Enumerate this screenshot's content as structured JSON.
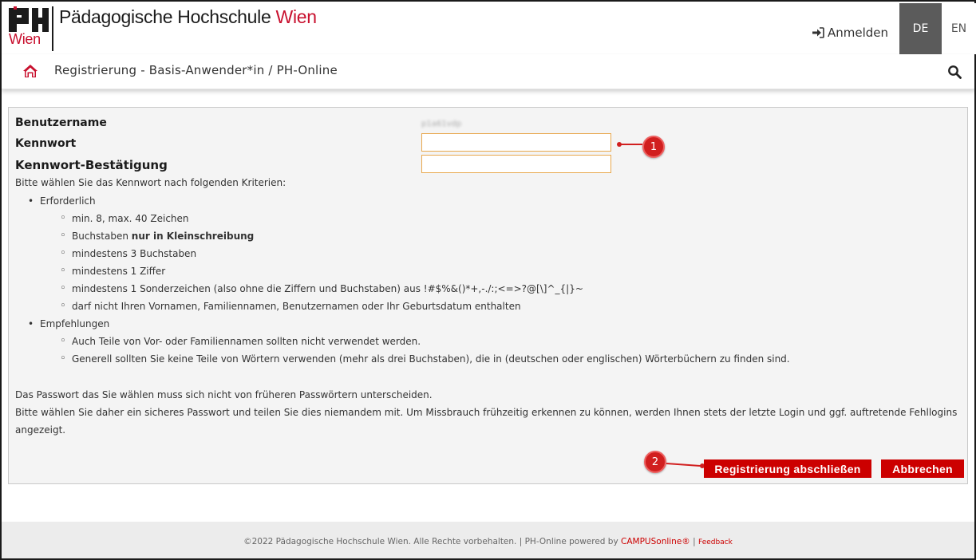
{
  "header": {
    "logo_wien": "Wien",
    "school_name": "Pädagogische Hochschule",
    "school_name_city": "Wien",
    "login_label": "Anmelden",
    "lang_de": "DE",
    "lang_en": "EN"
  },
  "nav": {
    "breadcrumb": "Registrierung - Basis-Anwender*in  / PH-Online"
  },
  "form": {
    "username_label": "Benutzername",
    "username_value": "p1a61vdp",
    "password_label": "Kennwort",
    "password_confirm_label": "Kennwort-Bestätigung",
    "password_value": "",
    "password_confirm_value": "",
    "intro": "Bitte wählen Sie das Kennwort nach folgenden Kriterien:",
    "required_heading": "Erforderlich",
    "required_items": {
      "i0": "min. 8, max. 40 Zeichen",
      "i1_pre": "Buchstaben ",
      "i1_bold": "nur in Kleinschreibung",
      "i2": "mindestens 3 Buchstaben",
      "i3": "mindestens 1 Ziffer",
      "i4": "mindestens 1 Sonderzeichen (also ohne die Ziffern und Buchstaben) aus !#$%&()*+,-./:;<=>?@[\\]^_{|}~",
      "i5": "darf nicht Ihren Vornamen, Familiennamen, Benutzernamen oder Ihr Geburtsdatum enthalten"
    },
    "recommend_heading": "Empfehlungen",
    "recommend_items": {
      "i0": "Auch Teile von Vor- oder Familiennamen sollten nicht verwendet werden.",
      "i1": "Generell sollten Sie keine Teile von Wörtern verwenden (mehr als drei Buchstaben), die in (deutschen oder englischen) Wörterbüchern zu finden sind."
    },
    "note1": "Das Passwort das Sie wählen muss sich nicht von früheren Passwörtern unterscheiden.",
    "note2": "Bitte wählen Sie daher ein sicheres Passwort und teilen Sie dies niemandem mit. Um Missbrauch frühzeitig erkennen zu können, werden Ihnen stets der letzte Login und ggf. auftretende Fehllogins",
    "note3": "angezeigt.",
    "submit_label": "Registrierung abschließen",
    "cancel_label": "Abbrechen"
  },
  "callouts": {
    "one": "1",
    "two": "2"
  },
  "footer": {
    "copyright": "©2022 Pädagogische Hochschule Wien. Alle Rechte vorbehalten. | PH-Online powered by ",
    "campus": "CAMPUSonline®",
    "sep": " | ",
    "feedback": "Feedback"
  },
  "colors": {
    "brand_red": "#c8102e",
    "button_red": "#cc0000",
    "callout_red": "#d11f1f",
    "input_border": "#e8a84e",
    "lang_active_bg": "#5b5b5b"
  },
  "icons": {
    "logo": "ph-logo",
    "login": "sign-in-icon",
    "home": "home-icon",
    "search": "search-icon"
  }
}
